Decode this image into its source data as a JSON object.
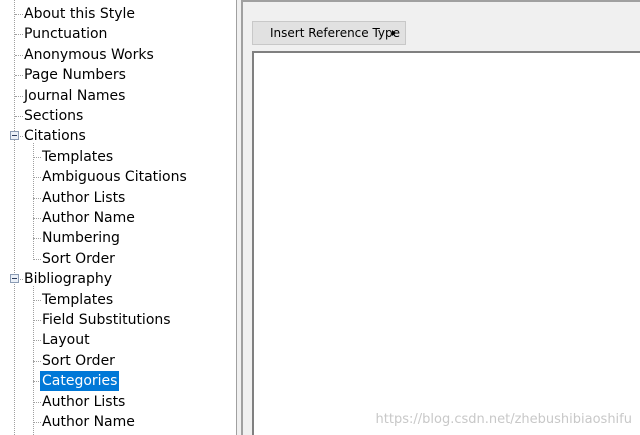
{
  "tree": {
    "top_items": [
      "About this Style",
      "Punctuation",
      "Anonymous Works",
      "Page Numbers",
      "Journal Names",
      "Sections"
    ],
    "citations": {
      "label": "Citations",
      "children": [
        "Templates",
        "Ambiguous Citations",
        "Author Lists",
        "Author Name",
        "Numbering",
        "Sort Order"
      ]
    },
    "bibliography": {
      "label": "Bibliography",
      "children": [
        "Templates",
        "Field Substitutions",
        "Layout",
        "Sort Order",
        "Categories",
        "Author Lists",
        "Author Name"
      ]
    },
    "selected": "Categories"
  },
  "toolbar": {
    "insert_reference_type": "Insert Reference Type"
  },
  "watermark": "https://blog.csdn.net/zhebushibiaoshifu",
  "colors": {
    "selection": "#0078d7"
  }
}
